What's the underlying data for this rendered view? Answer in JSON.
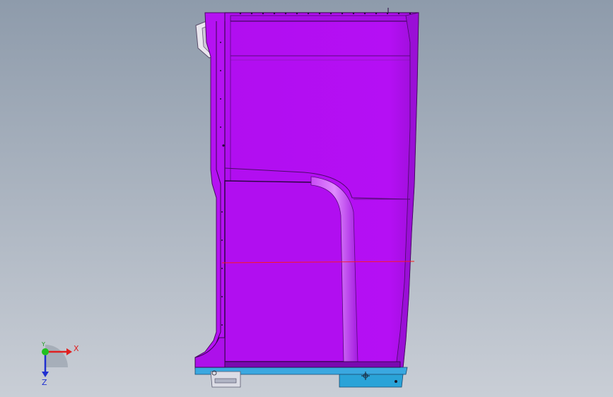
{
  "viewport": {
    "background_top": "#8e9bab",
    "background_bottom": "#c9ced6"
  },
  "model": {
    "body_color": "#b30ff2",
    "body_shade": "#9a10d8",
    "edge_color": "#4a0a66",
    "base_color": "#2aa3d8",
    "section_line_color": "#ff1a1a"
  },
  "triad": {
    "x_label": "X",
    "y_label": "Y",
    "z_label": "Z",
    "x_color": "#e02020",
    "y_color": "#20c020",
    "z_color": "#2030d0"
  }
}
